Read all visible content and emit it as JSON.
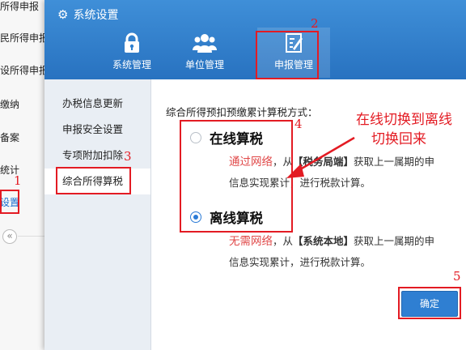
{
  "background_menu": {
    "items": [
      {
        "label": "所得申报"
      },
      {
        "label": "民所得申报"
      },
      {
        "label": "设所得申报"
      },
      {
        "label": "缴纳"
      },
      {
        "label": "备案"
      },
      {
        "label": "统计"
      },
      {
        "label": "设置"
      }
    ],
    "collapse_icon": "double-chevron-left-icon",
    "collapse_glyph": "«"
  },
  "dialog": {
    "title": "系统设置",
    "title_icon": "gear-icon",
    "tabs": [
      {
        "label": "系统管理",
        "icon": "lock-icon",
        "active": false
      },
      {
        "label": "单位管理",
        "icon": "users-icon",
        "active": false
      },
      {
        "label": "申报管理",
        "icon": "edit-document-icon",
        "active": true
      }
    ],
    "sidebar": [
      {
        "label": "办税信息更新",
        "active": false
      },
      {
        "label": "申报安全设置",
        "active": false
      },
      {
        "label": "专项附加扣除",
        "active": false
      },
      {
        "label": "综合所得算税",
        "active": true
      }
    ],
    "section_title": "综合所得预扣预缴累计算税方式：",
    "options": [
      {
        "label": "在线算税",
        "checked": false,
        "desc_red": "通过网络",
        "desc_mid": "，从",
        "desc_bold": "【税务局端】",
        "desc_rest": "获取上一属期的申",
        "desc_line2": "信息实现累计，进行税款计算。"
      },
      {
        "label": "离线算税",
        "checked": true,
        "desc_red": "无需网络",
        "desc_mid": "，从",
        "desc_bold": "【系统本地】",
        "desc_rest": "获取上一属期的申",
        "desc_line2": "信息实现累计，进行税款计算。"
      }
    ],
    "confirm_label": "确定"
  },
  "annotations": {
    "numbers": [
      "1",
      "2",
      "3",
      "4",
      "5"
    ],
    "note_line1": "在线切换到离线",
    "note_line2": "切换回来",
    "color": "#e31b23"
  },
  "colors": {
    "header_blue": "#2f80cf",
    "accent_blue": "#2a7ad6",
    "annotation_red": "#e31b23",
    "desc_red": "#e04848"
  }
}
